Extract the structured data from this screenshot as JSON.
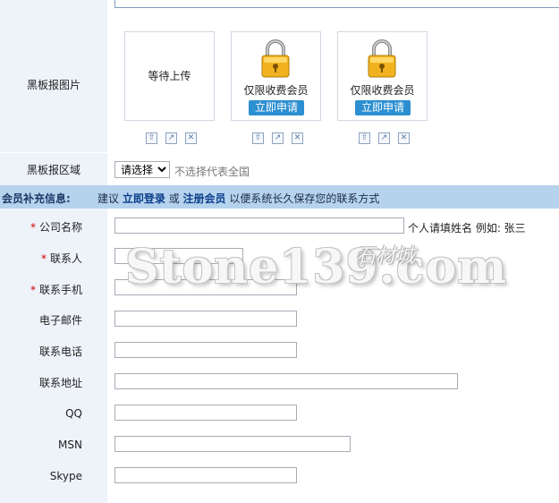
{
  "image_section": {
    "label": "黑板报图片",
    "slots": [
      {
        "status": "等待上传",
        "locked": false
      },
      {
        "status": "仅限收费会员",
        "apply_label": "立即申请",
        "locked": true
      },
      {
        "status": "仅限收费会员",
        "apply_label": "立即申请",
        "locked": true
      }
    ],
    "tool_icons": {
      "up": "⇧",
      "open": "↗",
      "remove": "✕"
    }
  },
  "region": {
    "label": "黑板报区域",
    "selected": "请选择",
    "hint": "不选择代表全国"
  },
  "member_banner": {
    "title": "会员补充信息:",
    "suggest": "建议",
    "login_link": "立即登录",
    "or": "或",
    "register_link": "注册会员",
    "tail": "以便系统长久保存您的联系方式"
  },
  "fields": {
    "company": {
      "label": "公司名称",
      "required": true,
      "note": "个人请填姓名 例如: 张三"
    },
    "contact": {
      "label": "联系人",
      "required": true
    },
    "mobile": {
      "label": "联系手机",
      "required": true
    },
    "email": {
      "label": "电子邮件"
    },
    "phone": {
      "label": "联系电话"
    },
    "address": {
      "label": "联系地址"
    },
    "qq": {
      "label": "QQ"
    },
    "msn": {
      "label": "MSN"
    },
    "skype": {
      "label": "Skype"
    }
  },
  "required_mark": "*",
  "watermark": {
    "text": "Stone139.com",
    "tag": "石材城"
  },
  "colors": {
    "label_bg": "#eef3fa",
    "banner_bg": "#b6d3ee",
    "apply_btn": "#2c8fd1",
    "required": "#d00000"
  }
}
